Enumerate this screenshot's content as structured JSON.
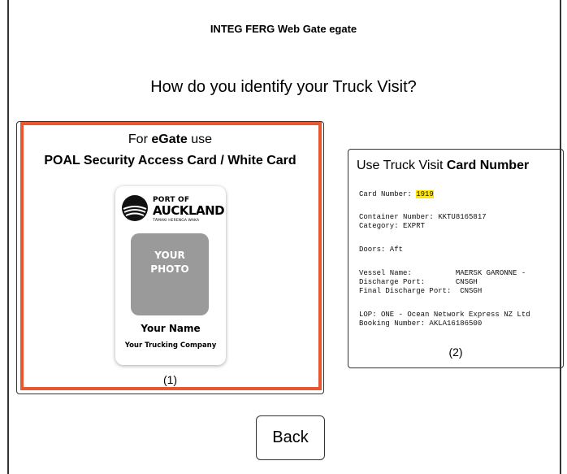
{
  "app_title": "INTEG FERG Web Gate egate",
  "question": "How do you identify your Truck Visit?",
  "option1": {
    "prefix": "For ",
    "bold_word": "eGate",
    "suffix": " use",
    "subtitle": "POAL Security Access Card / White Card",
    "badge": {
      "logo_line1": "PORT OF",
      "logo_line2": "AUCKLAND",
      "logo_line3": "TĀMAKI HERENGA WAKA",
      "photo_line1": "YOUR",
      "photo_line2": "PHOTO",
      "name": "Your Name",
      "company": "Your Trucking Company"
    },
    "index": "(1)",
    "highlight_color": "#e8572f"
  },
  "option2": {
    "heading_prefix": "Use Truck Visit ",
    "heading_bold": "Card Number",
    "ticket": {
      "card_number_label": "Card Number: ",
      "card_number_value": "1919",
      "container": "Container Number: KKTU8165817",
      "category": "Category: EXPRT",
      "doors": "Doors: Aft",
      "vessel": "Vessel Name:          MAERSK GARONNE -",
      "discharge": "Discharge Port:       CNSGH",
      "final_discharge": "Final Discharge Port:  CNSGH",
      "lop": "LOP: ONE - Ocean Network Express NZ Ltd",
      "booking": "Booking Number: AKLA16186500"
    },
    "index": "(2)",
    "highlight_color": "#ffe800"
  },
  "back_button": "Back"
}
